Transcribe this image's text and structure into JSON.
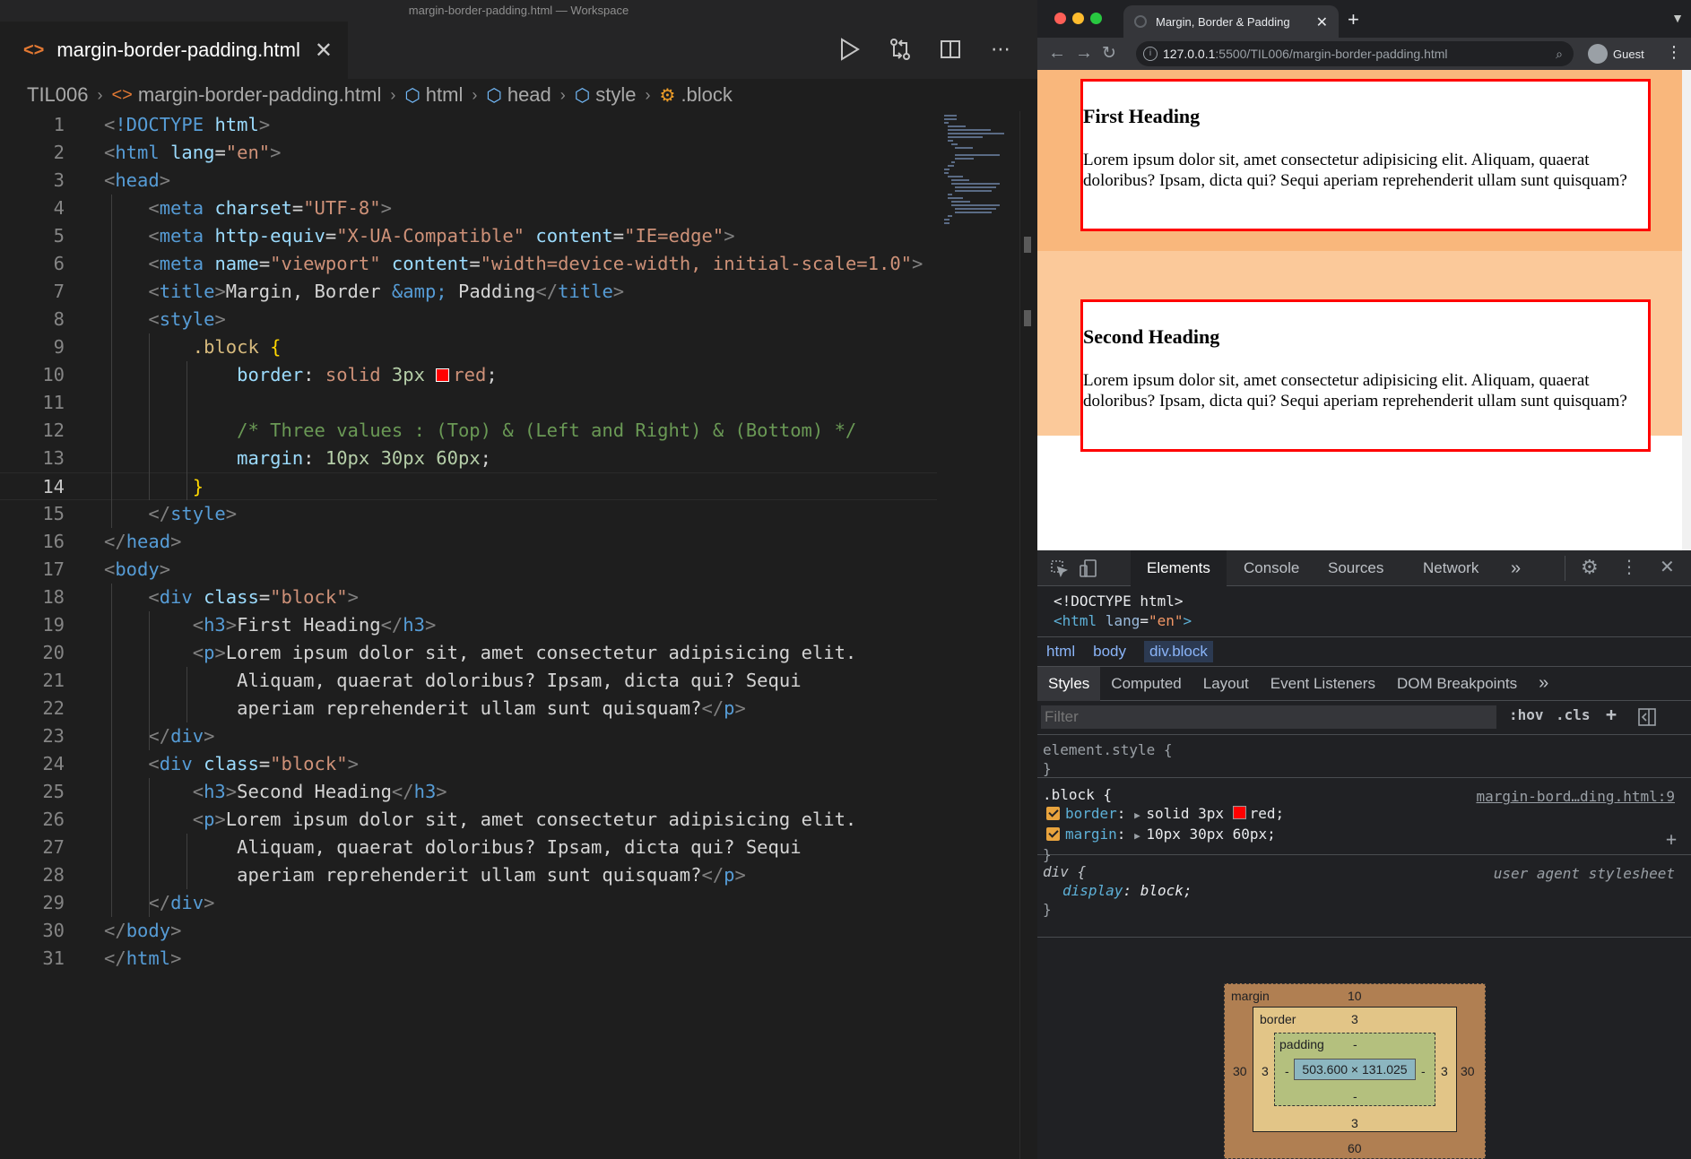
{
  "vscode": {
    "window_title": "margin-border-padding.html — Workspace",
    "tab": {
      "filename": "margin-border-padding.html",
      "icon": "html-file-icon"
    },
    "breadcrumb": [
      "TIL006",
      "margin-border-padding.html",
      "html",
      "head",
      "style",
      ".block"
    ],
    "active_line": 14,
    "code_lines": [
      {
        "n": "1",
        "tokens": [
          [
            "p",
            "<"
          ],
          [
            "tag",
            "!DOCTYPE"
          ],
          [
            "txt",
            " "
          ],
          [
            "attr",
            "html"
          ],
          [
            "p",
            ">"
          ]
        ]
      },
      {
        "n": "2",
        "tokens": [
          [
            "p",
            "<"
          ],
          [
            "tag",
            "html"
          ],
          [
            "txt",
            " "
          ],
          [
            "attr",
            "lang"
          ],
          [
            "txt",
            "="
          ],
          [
            "str",
            "\"en\""
          ],
          [
            "p",
            ">"
          ]
        ]
      },
      {
        "n": "3",
        "tokens": [
          [
            "p",
            "<"
          ],
          [
            "tag",
            "head"
          ],
          [
            "p",
            ">"
          ]
        ]
      },
      {
        "n": "4",
        "tokens": [
          [
            "txt",
            "    "
          ],
          [
            "p",
            "<"
          ],
          [
            "tag",
            "meta"
          ],
          [
            "txt",
            " "
          ],
          [
            "attr",
            "charset"
          ],
          [
            "txt",
            "="
          ],
          [
            "str",
            "\"UTF-8\""
          ],
          [
            "p",
            ">"
          ]
        ]
      },
      {
        "n": "5",
        "tokens": [
          [
            "txt",
            "    "
          ],
          [
            "p",
            "<"
          ],
          [
            "tag",
            "meta"
          ],
          [
            "txt",
            " "
          ],
          [
            "attr",
            "http-equiv"
          ],
          [
            "txt",
            "="
          ],
          [
            "str",
            "\"X-UA-Compatible\""
          ],
          [
            "txt",
            " "
          ],
          [
            "attr",
            "content"
          ],
          [
            "txt",
            "="
          ],
          [
            "str",
            "\"IE=edge\""
          ],
          [
            "p",
            ">"
          ]
        ]
      },
      {
        "n": "6",
        "tokens": [
          [
            "txt",
            "    "
          ],
          [
            "p",
            "<"
          ],
          [
            "tag",
            "meta"
          ],
          [
            "txt",
            " "
          ],
          [
            "attr",
            "name"
          ],
          [
            "txt",
            "="
          ],
          [
            "str",
            "\"viewport\""
          ],
          [
            "txt",
            " "
          ],
          [
            "attr",
            "content"
          ],
          [
            "txt",
            "="
          ],
          [
            "str",
            "\"width=device-width, initial-scale=1.0\""
          ],
          [
            "p",
            ">"
          ]
        ]
      },
      {
        "n": "7",
        "tokens": [
          [
            "txt",
            "    "
          ],
          [
            "p",
            "<"
          ],
          [
            "tag",
            "title"
          ],
          [
            "p",
            ">"
          ],
          [
            "txt",
            "Margin, Border "
          ],
          [
            "ent",
            "&amp;"
          ],
          [
            "txt",
            " Padding"
          ],
          [
            "p",
            "</"
          ],
          [
            "tag",
            "title"
          ],
          [
            "p",
            ">"
          ]
        ]
      },
      {
        "n": "8",
        "tokens": [
          [
            "txt",
            "    "
          ],
          [
            "p",
            "<"
          ],
          [
            "tag",
            "style"
          ],
          [
            "p",
            ">"
          ]
        ]
      },
      {
        "n": "9",
        "tokens": [
          [
            "txt",
            "        "
          ],
          [
            "sel",
            ".block"
          ],
          [
            "txt",
            " "
          ],
          [
            "brace",
            "{"
          ]
        ]
      },
      {
        "n": "10",
        "tokens": [
          [
            "txt",
            "            "
          ],
          [
            "prop",
            "border"
          ],
          [
            "txt",
            ": "
          ],
          [
            "val",
            "solid"
          ],
          [
            "txt",
            " "
          ],
          [
            "num",
            "3px"
          ],
          [
            "txt",
            " "
          ],
          [
            "swatch",
            ""
          ],
          [
            "val",
            "red"
          ],
          [
            "txt",
            ";"
          ]
        ]
      },
      {
        "n": "11",
        "tokens": []
      },
      {
        "n": "12",
        "tokens": [
          [
            "txt",
            "            "
          ],
          [
            "com",
            "/* Three values : (Top) & (Left and Right) & (Bottom) */"
          ]
        ]
      },
      {
        "n": "13",
        "tokens": [
          [
            "txt",
            "            "
          ],
          [
            "prop",
            "margin"
          ],
          [
            "txt",
            ": "
          ],
          [
            "num",
            "10px"
          ],
          [
            "txt",
            " "
          ],
          [
            "num",
            "30px"
          ],
          [
            "txt",
            " "
          ],
          [
            "num",
            "60px"
          ],
          [
            "txt",
            ";"
          ]
        ]
      },
      {
        "n": "14",
        "tokens": [
          [
            "txt",
            "        "
          ],
          [
            "brace",
            "}"
          ]
        ]
      },
      {
        "n": "15",
        "tokens": [
          [
            "txt",
            "    "
          ],
          [
            "p",
            "</"
          ],
          [
            "tag",
            "style"
          ],
          [
            "p",
            ">"
          ]
        ]
      },
      {
        "n": "16",
        "tokens": [
          [
            "p",
            "</"
          ],
          [
            "tag",
            "head"
          ],
          [
            "p",
            ">"
          ]
        ]
      },
      {
        "n": "17",
        "tokens": [
          [
            "p",
            "<"
          ],
          [
            "tag",
            "body"
          ],
          [
            "p",
            ">"
          ]
        ]
      },
      {
        "n": "18",
        "tokens": [
          [
            "txt",
            "    "
          ],
          [
            "p",
            "<"
          ],
          [
            "tag",
            "div"
          ],
          [
            "txt",
            " "
          ],
          [
            "attr",
            "class"
          ],
          [
            "txt",
            "="
          ],
          [
            "str",
            "\"block\""
          ],
          [
            "p",
            ">"
          ]
        ]
      },
      {
        "n": "19",
        "tokens": [
          [
            "txt",
            "        "
          ],
          [
            "p",
            "<"
          ],
          [
            "tag",
            "h3"
          ],
          [
            "p",
            ">"
          ],
          [
            "txt",
            "First Heading"
          ],
          [
            "p",
            "</"
          ],
          [
            "tag",
            "h3"
          ],
          [
            "p",
            ">"
          ]
        ]
      },
      {
        "n": "20",
        "tokens": [
          [
            "txt",
            "        "
          ],
          [
            "p",
            "<"
          ],
          [
            "tag",
            "p"
          ],
          [
            "p",
            ">"
          ],
          [
            "txt",
            "Lorem ipsum dolor sit, amet consectetur adipisicing elit."
          ]
        ]
      },
      {
        "n": "21",
        "tokens": [
          [
            "txt",
            "            Aliquam, quaerat doloribus? Ipsam, dicta qui? Sequi"
          ]
        ]
      },
      {
        "n": "22",
        "tokens": [
          [
            "txt",
            "            aperiam reprehenderit ullam sunt quisquam?"
          ],
          [
            "p",
            "</"
          ],
          [
            "tag",
            "p"
          ],
          [
            "p",
            ">"
          ]
        ]
      },
      {
        "n": "23",
        "tokens": [
          [
            "txt",
            "    "
          ],
          [
            "p",
            "</"
          ],
          [
            "tag",
            "div"
          ],
          [
            "p",
            ">"
          ]
        ]
      },
      {
        "n": "24",
        "tokens": [
          [
            "txt",
            "    "
          ],
          [
            "p",
            "<"
          ],
          [
            "tag",
            "div"
          ],
          [
            "txt",
            " "
          ],
          [
            "attr",
            "class"
          ],
          [
            "txt",
            "="
          ],
          [
            "str",
            "\"block\""
          ],
          [
            "p",
            ">"
          ]
        ]
      },
      {
        "n": "25",
        "tokens": [
          [
            "txt",
            "        "
          ],
          [
            "p",
            "<"
          ],
          [
            "tag",
            "h3"
          ],
          [
            "p",
            ">"
          ],
          [
            "txt",
            "Second Heading"
          ],
          [
            "p",
            "</"
          ],
          [
            "tag",
            "h3"
          ],
          [
            "p",
            ">"
          ]
        ]
      },
      {
        "n": "26",
        "tokens": [
          [
            "txt",
            "        "
          ],
          [
            "p",
            "<"
          ],
          [
            "tag",
            "p"
          ],
          [
            "p",
            ">"
          ],
          [
            "txt",
            "Lorem ipsum dolor sit, amet consectetur adipisicing elit."
          ]
        ]
      },
      {
        "n": "27",
        "tokens": [
          [
            "txt",
            "            Aliquam, quaerat doloribus? Ipsam, dicta qui? Sequi"
          ]
        ]
      },
      {
        "n": "28",
        "tokens": [
          [
            "txt",
            "            aperiam reprehenderit ullam sunt quisquam?"
          ],
          [
            "p",
            "</"
          ],
          [
            "tag",
            "p"
          ],
          [
            "p",
            ">"
          ]
        ]
      },
      {
        "n": "29",
        "tokens": [
          [
            "txt",
            "    "
          ],
          [
            "p",
            "</"
          ],
          [
            "tag",
            "div"
          ],
          [
            "p",
            ">"
          ]
        ]
      },
      {
        "n": "30",
        "tokens": [
          [
            "p",
            "</"
          ],
          [
            "tag",
            "body"
          ],
          [
            "p",
            ">"
          ]
        ]
      },
      {
        "n": "31",
        "tokens": [
          [
            "p",
            "</"
          ],
          [
            "tag",
            "html"
          ],
          [
            "p",
            ">"
          ]
        ]
      }
    ]
  },
  "browser": {
    "tab_title": "Margin, Border & Padding",
    "url_host": "127.0.0.1",
    "url_path": ":5500/TIL006/margin-border-padding.html",
    "profile_label": "Guest",
    "page": {
      "blocks": [
        {
          "heading": "First Heading",
          "text": "Lorem ipsum dolor sit, amet consectetur adipisicing elit. Aliquam, quaerat doloribus? Ipsam, dicta qui? Sequi aperiam reprehenderit ullam sunt quisquam?"
        },
        {
          "heading": "Second Heading",
          "text": "Lorem ipsum dolor sit, amet consectetur adipisicing elit. Aliquam, quaerat doloribus? Ipsam, dicta qui? Sequi aperiam reprehenderit ullam sunt quisquam?"
        }
      ]
    },
    "devtools": {
      "tabs": [
        "Elements",
        "Console",
        "Sources",
        "Network"
      ],
      "more_tabs": "»",
      "dom_line1": "<!DOCTYPE html>",
      "dom_line2_tag": "<html",
      "dom_line2_attr": "lang",
      "dom_line2_val": "\"en\"",
      "dom_line2_close": ">",
      "crumbs": [
        "html",
        "body",
        "div.block"
      ],
      "subtabs": [
        "Styles",
        "Computed",
        "Layout",
        "Event Listeners",
        "DOM Breakpoints"
      ],
      "filter_placeholder": "Filter",
      "hov": ":hov",
      "cls": ".cls",
      "element_style_open": "element.style {",
      "close_brace": "}",
      "block_rule": {
        "selector": ".block {",
        "source": "margin-bord…ding.html:9",
        "props": [
          {
            "name": "border",
            "value": "solid 3px",
            "swatch": true,
            "value2": "red;"
          },
          {
            "name": "margin",
            "value": "10px 30px 60px;",
            "swatch": false,
            "value2": ""
          }
        ]
      },
      "ua_rule": {
        "selector": "div {",
        "source": "user agent stylesheet",
        "prop_name": "display",
        "prop_value": "block;"
      },
      "box_model": {
        "margin_label": "margin",
        "margin_top": "10",
        "margin_right": "30",
        "margin_bottom": "60",
        "margin_left": "30",
        "border_label": "border",
        "border_top": "3",
        "border_right": "3",
        "border_bottom": "3",
        "border_left": "3",
        "padding_label": "padding",
        "padding_top": "-",
        "padding_right": "-",
        "padding_bottom": "-",
        "padding_left": "-",
        "content_size": "503.600 × 131.025",
        "colors": {
          "margin": "#b07f52",
          "border": "#e2c587",
          "padding": "#b4c07e",
          "content": "#8cb6c0"
        }
      }
    }
  },
  "colors": {
    "red": "#ff0000",
    "viewport_top": "#f9b77c",
    "viewport_bottom": "#fbc99a",
    "accent_orange": "#e8a33d"
  }
}
